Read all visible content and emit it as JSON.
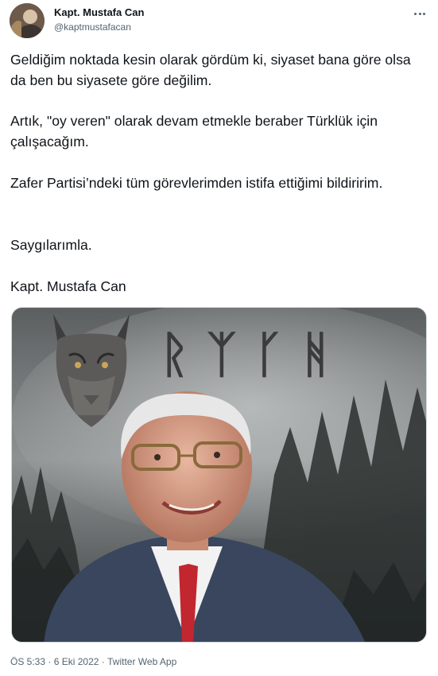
{
  "author": {
    "display_name": "Kapt. Mustafa Can",
    "handle": "@kaptmustafacan",
    "avatar_icon": "profile-avatar"
  },
  "more_icon": "more-horizontal-icon",
  "tweet": {
    "paragraphs": [
      "Geldiğim noktada kesin olarak gördüm ki, siyaset bana göre olsa da ben bu siyasete göre değilim.",
      "Artık, \"oy veren\" olarak devam etmekle beraber Türklük için çalışacağım.",
      "Zafer Partisi’ndeki tüm görevlerimden istifa ettiğimi bildiririm.",
      "Saygılarımla.",
      "Kapt. Mustafa Can"
    ]
  },
  "media": {
    "rune_text": "ᚱᛉᚴᚻ"
  },
  "meta": {
    "time": "ÖS 5:33",
    "separator": "·",
    "date": "6 Eki 2022",
    "source": "Twitter Web App"
  },
  "colors": {
    "text_primary": "#0f1419",
    "text_secondary": "#536471",
    "border": "#cfd9de"
  }
}
